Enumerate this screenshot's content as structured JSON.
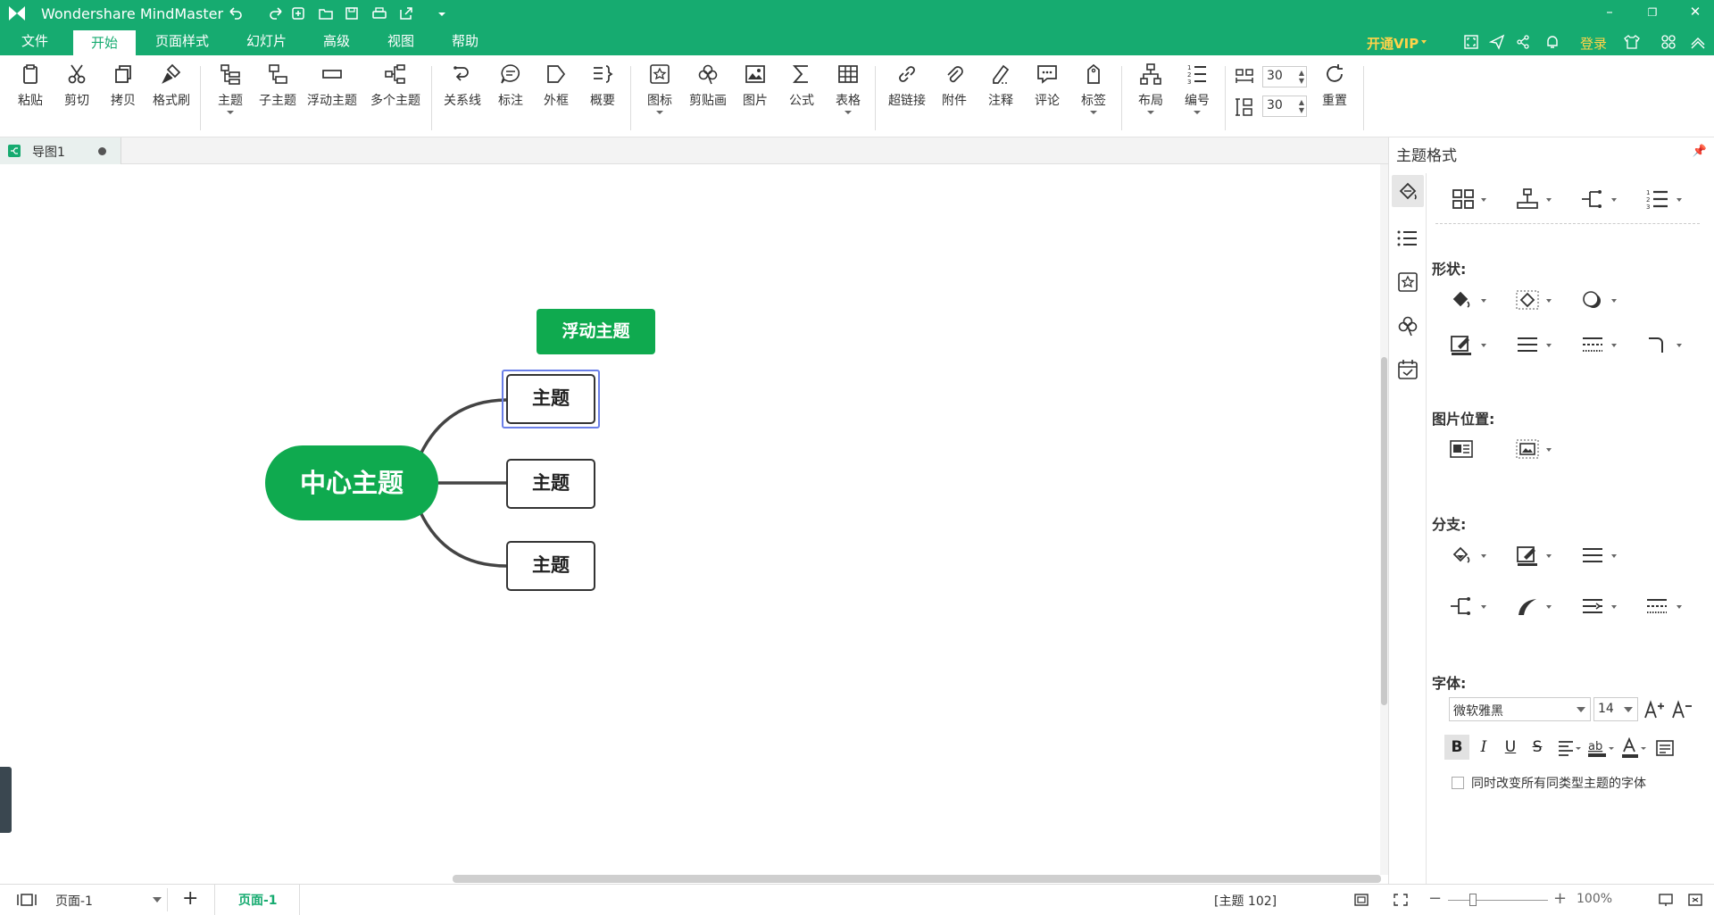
{
  "app": {
    "title": "Wondershare MindMaster"
  },
  "menu": {
    "items": [
      "文件",
      "开始",
      "页面样式",
      "幻灯片",
      "高级",
      "视图",
      "帮助"
    ],
    "active": "开始",
    "vip": "开通VIP",
    "login": "登录"
  },
  "ribbon": {
    "paste": "粘贴",
    "cut": "剪切",
    "copy": "拷贝",
    "format_painter": "格式刷",
    "topic": "主题",
    "subtopic": "子主题",
    "floating_topic": "浮动主题",
    "multi_topic": "多个主题",
    "relation": "关系线",
    "callout": "标注",
    "boundary": "外框",
    "summary": "概要",
    "icon": "图标",
    "clipart": "剪贴画",
    "image": "图片",
    "formula": "公式",
    "table": "表格",
    "hyperlink": "超链接",
    "attachment": "附件",
    "note": "注释",
    "comment": "评论",
    "tag": "标签",
    "layout": "布局",
    "numbering": "编号",
    "reset": "重置",
    "h_spacing": "30",
    "v_spacing": "30"
  },
  "tabs": {
    "doc_name": "导图1"
  },
  "map": {
    "central": "中心主题",
    "floating": "浮动主题",
    "topics": [
      "主题",
      "主题",
      "主题"
    ]
  },
  "panel": {
    "title": "主题格式",
    "shape_label": "形状:",
    "image_pos_label": "图片位置:",
    "branch_label": "分支:",
    "font_label": "字体:",
    "font_name": "微软雅黑",
    "font_size": "14",
    "apply_all": "同时改变所有同类型主题的字体"
  },
  "status": {
    "page_select": "页面-1",
    "page_tab": "页面-1",
    "topic_info": "[主题 102]",
    "zoom": "100%"
  }
}
